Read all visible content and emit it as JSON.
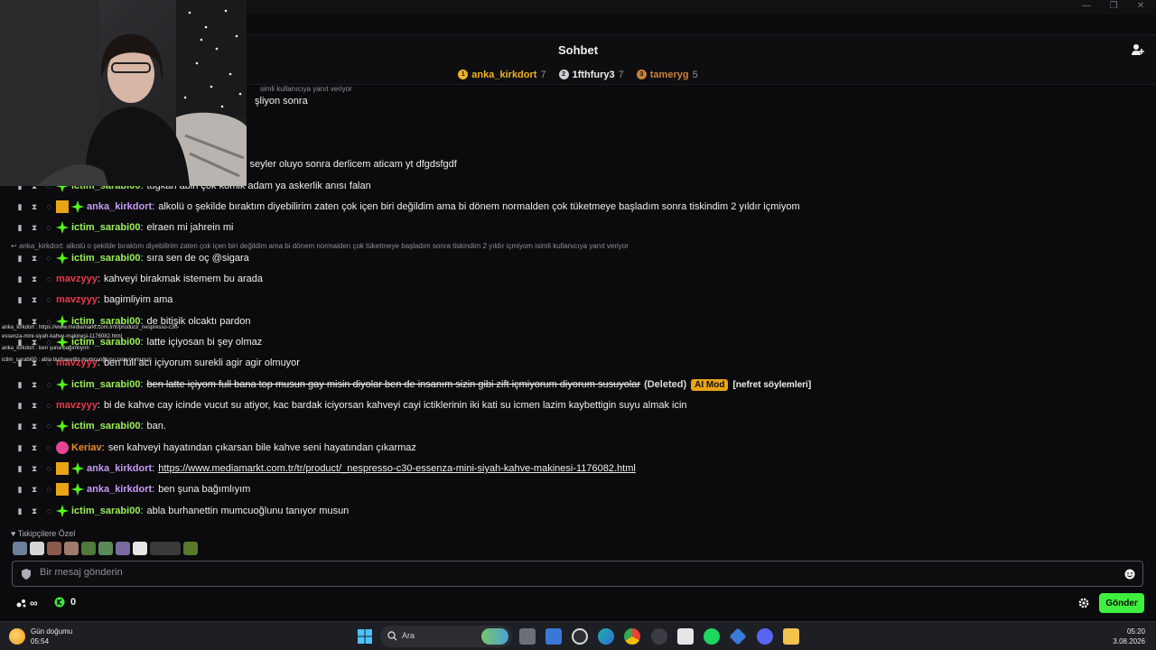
{
  "window": {
    "minimize": "—",
    "maximize": "❐",
    "close": "✕"
  },
  "chat": {
    "title": "Sohbet",
    "leaderboard": [
      {
        "rank": "1",
        "name": "anka_kirkdort",
        "count": "7",
        "color": "#f0b323"
      },
      {
        "rank": "2",
        "name": "1fthfury3",
        "count": "7",
        "color": "#cfcfd4"
      },
      {
        "rank": "3",
        "name": "tameryg",
        "count": "5",
        "color": "#c9803c"
      }
    ],
    "top_reply": "simli kullanıcıya yanıt veriyor",
    "partial_lines": [
      {
        "text": "şliyon sonra"
      },
      {
        "text": "k seyler oluyo sonra derlicem aticam yt dfgdsfgdf"
      }
    ],
    "messages": [
      {
        "user": "ictim_sarabi00",
        "color": "#9bf05a",
        "text": "tugkan abin çok komik adam ya askerlik anısı falan"
      },
      {
        "user": "anka_kirkdort",
        "color": "#c89bf5",
        "text": "alkolü o şekilde bıraktım diyebilirim zaten çok içen biri değildim ama bi dönem normalden çok tüketmeye başladım sonra tiskindim 2 yıldır içmiyom"
      },
      {
        "user": "ictim_sarabi00",
        "color": "#9bf05a",
        "text": "elraen mi jahrein mi"
      },
      {
        "user": "ictim_sarabi00",
        "color": "#9bf05a",
        "text": "sıra sen de oç @sigara"
      },
      {
        "user": "mavzyyy",
        "color": "#e8394b",
        "text": "kahveyi birakmak istemem bu arada"
      },
      {
        "user": "mavzyyy",
        "color": "#e8394b",
        "text": "bagimliyim ama"
      },
      {
        "user": "ictim_sarabi00",
        "color": "#9bf05a",
        "text": "de bitişik olcaktı pardon"
      },
      {
        "user": "ictim_sarabi00",
        "color": "#9bf05a",
        "text": "latte içiyosan bi şey olmaz"
      },
      {
        "user": "mavzyyy",
        "color": "#e8394b",
        "text": "ben full acı içiyorum surekli agir agir olmuyor"
      },
      {
        "user": "ictim_sarabi00",
        "color": "#9bf05a",
        "text": "ben latte içiyom full bana top musun gay misin diyolar ben de insanım sizin gibi zift içmiyorum diyorum susuyolar",
        "deleted": "(Deleted)",
        "tag": "AI Mod",
        "reason": "[nefret söylemleri]"
      },
      {
        "user": "mavzyyy",
        "color": "#e8394b",
        "text": "bi de kahve cay icinde vucut su atiyor, kac bardak iciyorsan kahveyi cayi ictiklerinin iki kati su icmen lazim kaybettigin suyu almak icin"
      },
      {
        "user": "ictim_sarabi00",
        "color": "#9bf05a",
        "text": "ban."
      },
      {
        "user": "Keriav",
        "color": "#f08a2c",
        "text": "sen kahveyi hayatından çıkarsan bile kahve seni hayatından çıkarmaz"
      },
      {
        "user": "anka_kirkdort",
        "color": "#c89bf5",
        "text": "https://www.mediamarkt.com.tr/tr/product/_nespresso-c30-essenza-mini-siyah-kahve-makinesi-1176082.html"
      },
      {
        "user": "anka_kirkdort",
        "color": "#c89bf5",
        "text": "ben şuna bağımlıyım"
      },
      {
        "user": "ictim_sarabi00",
        "color": "#9bf05a",
        "text": "abla burhanettin mumcuoğlunu tanıyor musun"
      }
    ],
    "reply_context": "anka_kirkdort: alkolü o şekilde bıraktım diyebilirim zaten çok içen biri değildim ama bi dönem normalden çok tüketmeye başladım sonra tiskindim 2 yıldır içmiyom isimli kullanıcıya yanıt veriyor",
    "overlay": [
      "anka_kirkdort : https://www.mediamarkt.com.tr/tr/product/_nespresso-c30-",
      "essenza-mini-siyah-kahve-makinesi-1176082.html",
      "anka_kirkdort : ben şuna bağımlıyım",
      "ictim_sarabi00 : abla burhanettin mumcuoğlunu tanıyor musun"
    ],
    "followers_only": "Takipçilere Özel",
    "input_placeholder": "Bir mesaj gönderin",
    "infinity": "∞",
    "points": "0",
    "send_label": "Gönder"
  },
  "taskbar": {
    "weather_title": "Gün doğumu",
    "weather_time": "05:54",
    "search_label": "Ara",
    "time": "05:20",
    "date": "3.08.2026"
  }
}
